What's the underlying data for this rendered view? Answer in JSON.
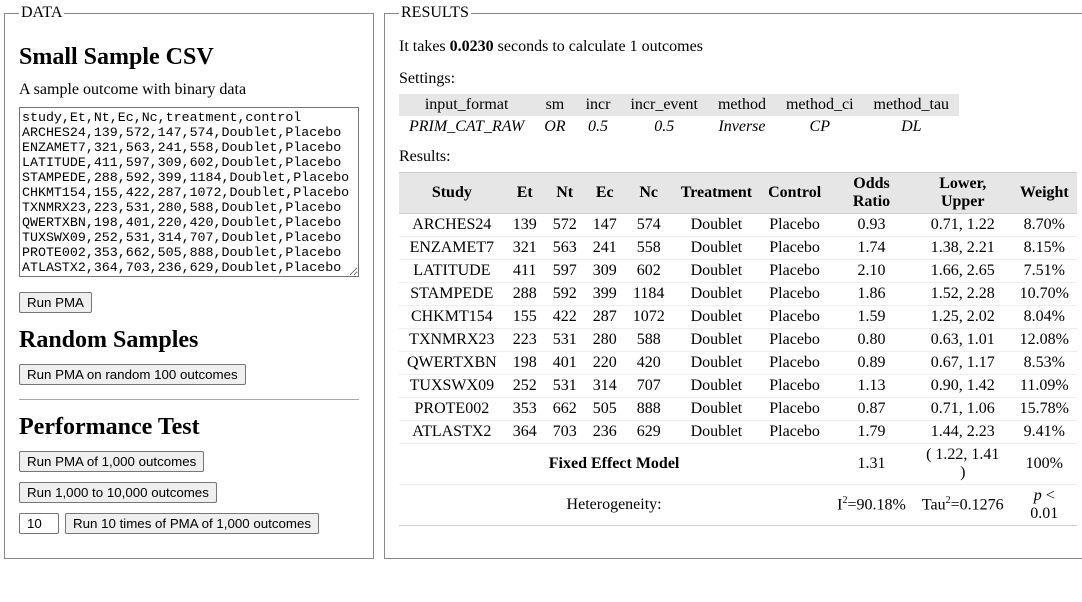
{
  "data_panel": {
    "legend": "DATA",
    "section1": {
      "title": "Small Sample CSV",
      "desc": "A sample outcome with binary data",
      "csv": "study,Et,Nt,Ec,Nc,treatment,control\nARCHES24,139,572,147,574,Doublet,Placebo\nENZAMET7,321,563,241,558,Doublet,Placebo\nLATITUDE,411,597,309,602,Doublet,Placebo\nSTAMPEDE,288,592,399,1184,Doublet,Placebo\nCHKMT154,155,422,287,1072,Doublet,Placebo\nTXNMRX23,223,531,280,588,Doublet,Placebo\nQWERTXBN,198,401,220,420,Doublet,Placebo\nTUXSWX09,252,531,314,707,Doublet,Placebo\nPROTE002,353,662,505,888,Doublet,Placebo\nATLASTX2,364,703,236,629,Doublet,Placebo",
      "run_btn": "Run PMA"
    },
    "section2": {
      "title": "Random Samples",
      "btn": "Run PMA on random 100 outcomes"
    },
    "section3": {
      "title": "Performance Test",
      "btn1": "Run PMA of 1,000 outcomes",
      "btn2": "Run 1,000 to 10,000 outcomes",
      "num_value": "10",
      "btn3": "Run 10 times of PMA of 1,000 outcomes"
    }
  },
  "results_panel": {
    "legend": "RESULTS",
    "sentence_pre": "It takes ",
    "sentence_bold": "0.0230",
    "sentence_post": " seconds to calculate 1 outcomes",
    "settings_label": "Settings:",
    "settings_headers": [
      "input_format",
      "sm",
      "incr",
      "incr_event",
      "method",
      "method_ci",
      "method_tau"
    ],
    "settings_values": [
      "PRIM_CAT_RAW",
      "OR",
      "0.5",
      "0.5",
      "Inverse",
      "CP",
      "DL"
    ],
    "results_label": "Results:",
    "headers": [
      "Study",
      "Et",
      "Nt",
      "Ec",
      "Nc",
      "Treatment",
      "Control",
      "Odds Ratio",
      "Lower, Upper",
      "Weight"
    ],
    "rows": [
      {
        "c": [
          "ARCHES24",
          "139",
          "572",
          "147",
          "574",
          "Doublet",
          "Placebo",
          "0.93",
          "0.71, 1.22",
          "8.70%"
        ]
      },
      {
        "c": [
          "ENZAMET7",
          "321",
          "563",
          "241",
          "558",
          "Doublet",
          "Placebo",
          "1.74",
          "1.38, 2.21",
          "8.15%"
        ]
      },
      {
        "c": [
          "LATITUDE",
          "411",
          "597",
          "309",
          "602",
          "Doublet",
          "Placebo",
          "2.10",
          "1.66, 2.65",
          "7.51%"
        ]
      },
      {
        "c": [
          "STAMPEDE",
          "288",
          "592",
          "399",
          "1184",
          "Doublet",
          "Placebo",
          "1.86",
          "1.52, 2.28",
          "10.70%"
        ]
      },
      {
        "c": [
          "CHKMT154",
          "155",
          "422",
          "287",
          "1072",
          "Doublet",
          "Placebo",
          "1.59",
          "1.25, 2.02",
          "8.04%"
        ]
      },
      {
        "c": [
          "TXNMRX23",
          "223",
          "531",
          "280",
          "588",
          "Doublet",
          "Placebo",
          "0.80",
          "0.63, 1.01",
          "12.08%"
        ]
      },
      {
        "c": [
          "QWERTXBN",
          "198",
          "401",
          "220",
          "420",
          "Doublet",
          "Placebo",
          "0.89",
          "0.67, 1.17",
          "8.53%"
        ]
      },
      {
        "c": [
          "TUXSWX09",
          "252",
          "531",
          "314",
          "707",
          "Doublet",
          "Placebo",
          "1.13",
          "0.90, 1.42",
          "11.09%"
        ]
      },
      {
        "c": [
          "PROTE002",
          "353",
          "662",
          "505",
          "888",
          "Doublet",
          "Placebo",
          "0.87",
          "0.71, 1.06",
          "15.78%"
        ]
      },
      {
        "c": [
          "ATLASTX2",
          "364",
          "703",
          "236",
          "629",
          "Doublet",
          "Placebo",
          "1.79",
          "1.44, 2.23",
          "9.41%"
        ]
      }
    ],
    "fixed": {
      "label": "Fixed Effect Model",
      "or": "1.31",
      "ci": "( 1.22, 1.41 )",
      "wt": "100%"
    },
    "het": {
      "label": "Heterogeneity:",
      "i2": "90.18%",
      "tau2": "0.1276",
      "p": "< 0.01"
    }
  }
}
